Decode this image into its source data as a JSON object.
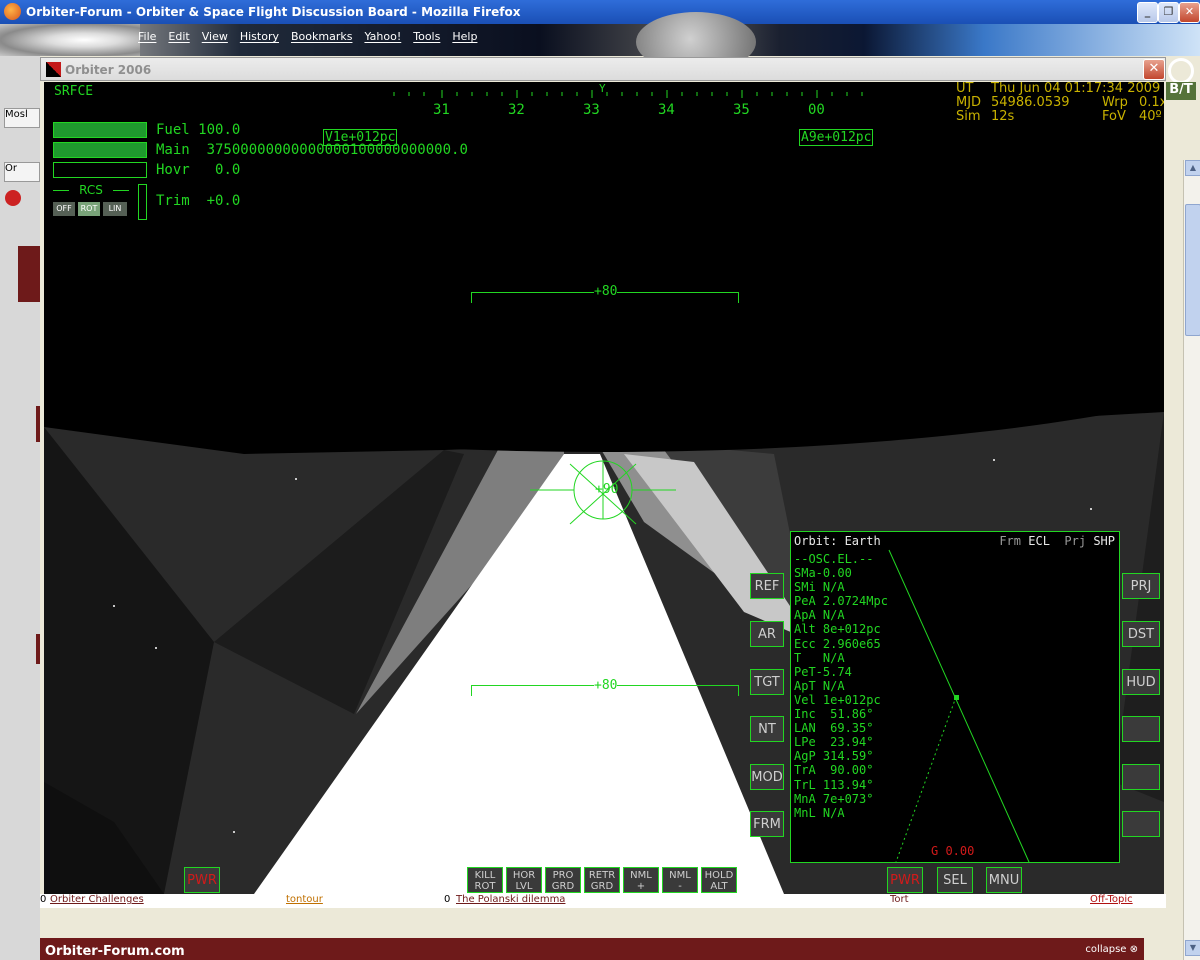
{
  "firefox": {
    "title": "Orbiter-Forum - Orbiter & Space Flight Discussion Board - Mozilla Firefox",
    "menu": [
      "File",
      "Edit",
      "View",
      "History",
      "Bookmarks",
      "Yahoo!",
      "Tools",
      "Help"
    ],
    "side_tabs": [
      "Mosl",
      "Or"
    ],
    "right_badge": "B/T"
  },
  "forum": {
    "row_left_count": "0",
    "row_left_title": "Orbiter Challenges",
    "row_left_user": "tontour",
    "row_mid_count": "0",
    "row_mid_title": "The Polanski dilemma",
    "row_right_user": "Tort",
    "row_right_forum": "Off-Topic",
    "footer_title": "Orbiter-Forum.com",
    "footer_collapse": "collapse"
  },
  "orbiter": {
    "window_title": "Orbiter 2006",
    "hud": {
      "mode": "SRFCE",
      "heading_labels": [
        "31",
        "32",
        "33",
        "34",
        "35",
        "00"
      ],
      "heading_marker": "Y",
      "velocity_marker": "V1e+012pc",
      "accel_marker": "A9e+012pc",
      "pitch_upper": "+80",
      "pitch_lower": "+80",
      "pitch_center": "+90"
    },
    "time": {
      "ut_label": "UT",
      "ut_value": "Thu Jun 04 01:17:34 2009",
      "mjd_label": "MJD",
      "mjd_value": "54986.0539",
      "wrp_label": "Wrp",
      "wrp_value": "0.1x",
      "sim_label": "Sim",
      "sim_value": "12s",
      "fov_label": "FoV",
      "fov_value": "40º"
    },
    "engines": {
      "fuel_label": "Fuel",
      "fuel_value": "100.0",
      "main_label": "Main",
      "main_value": "37500000000000000100000000000.0",
      "hovr_label": "Hovr",
      "hovr_value": "0.0",
      "trim_label": "Trim",
      "trim_value": "+0.0",
      "rcs_label": "RCS",
      "rcs_buttons": [
        "OFF",
        "ROT",
        "LIN"
      ]
    },
    "mfd": {
      "header": "Orbit: Earth",
      "frm_label": "Frm",
      "frm_value": "ECL",
      "prj_label": "Prj",
      "prj_value": "SHP",
      "elements": "--OSC.EL.--\nSMa-0.00\nSMi N/A\nPeA 2.0724Mpc\nApA N/A\nAlt 8e+012pc\nEcc 2.960e65\nT   N/A\nPeT-5.74\nApT N/A\nVel 1e+012pc\nInc  51.86°\nLAN  69.35°\nLPe  23.94°\nAgP 314.59°\nTrA  90.00°\nTrL 113.94°\nMnA 7e+073°\nMnL N/A",
      "g_value": "G 0.00",
      "left_buttons": [
        "REF",
        "AR",
        "TGT",
        "NT",
        "MOD",
        "FRM"
      ],
      "right_buttons": [
        "PRJ",
        "DST",
        "HUD",
        "",
        "",
        ""
      ],
      "bottom_buttons": [
        "PWR",
        "SEL",
        "MNU"
      ]
    },
    "left_pwr": "PWR",
    "autopilot": [
      {
        "l1": "KILL",
        "l2": "ROT"
      },
      {
        "l1": "HOR",
        "l2": "LVL"
      },
      {
        "l1": "PRO",
        "l2": "GRD"
      },
      {
        "l1": "RETR",
        "l2": "GRD"
      },
      {
        "l1": "NML",
        "l2": "+"
      },
      {
        "l1": "NML",
        "l2": "-"
      },
      {
        "l1": "HOLD",
        "l2": "ALT"
      }
    ],
    "colors": {
      "hud": "#22d622",
      "time": "#c9b200",
      "pwr": "#d21a1a"
    }
  }
}
